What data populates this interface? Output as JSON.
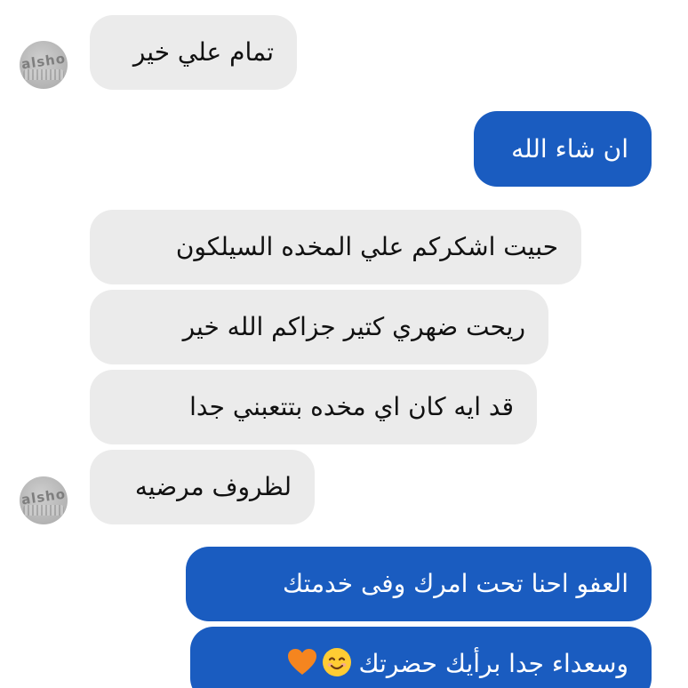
{
  "contact": {
    "avatar_text": "alsho"
  },
  "messages": [
    {
      "direction": "incoming",
      "text": "تمام علي خير"
    },
    {
      "direction": "outgoing",
      "text": "ان شاء الله"
    },
    {
      "direction": "incoming",
      "text": "حبيت اشكركم علي المخده السيلكون"
    },
    {
      "direction": "incoming",
      "text": "ريحت ضهري كتير جزاكم الله خير"
    },
    {
      "direction": "incoming",
      "text": "قد ايه كان اي مخده بتتعبني جدا"
    },
    {
      "direction": "incoming",
      "text": "لظروف مرضيه"
    },
    {
      "direction": "outgoing",
      "text": "العفو احنا تحت امرك وفى خدمتك"
    },
    {
      "direction": "outgoing",
      "text": "وسعداء جدا برأيك حضرتك",
      "emojis": [
        "smiling-face-icon",
        "orange-heart-icon"
      ]
    }
  ],
  "colors": {
    "incoming_bubble": "#ebebeb",
    "outgoing_bubble": "#1a5cc0",
    "incoming_text": "#111111",
    "outgoing_text": "#ffffff"
  }
}
